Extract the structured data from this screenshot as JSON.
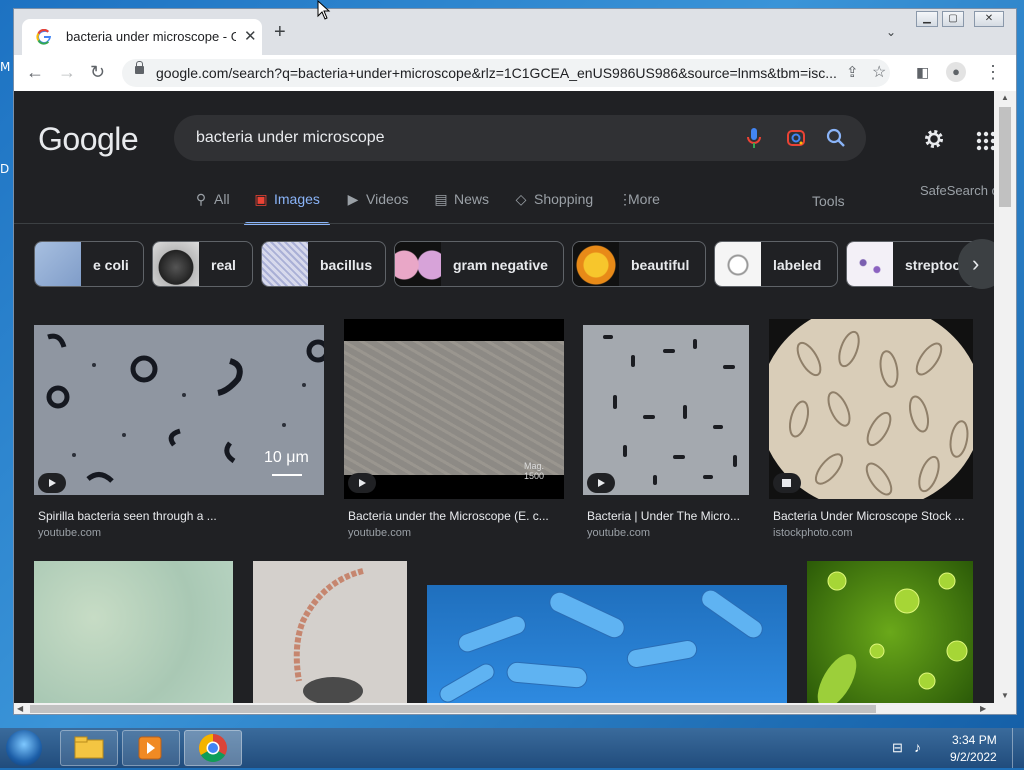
{
  "desktop": {
    "edge_texts": [
      "M",
      "D"
    ]
  },
  "browser": {
    "tab_title": "bacteria under microscope - Goo",
    "url": "google.com/search?q=bacteria+under+microscope&rlz=1C1GCEA_enUS986US986&source=lnms&tbm=isc..."
  },
  "google": {
    "logo": "Google",
    "query": "bacteria under microscope",
    "tabs": [
      {
        "label": "All",
        "icon": "search-icon"
      },
      {
        "label": "Images",
        "icon": "image-icon",
        "active": true
      },
      {
        "label": "Videos",
        "icon": "video-icon"
      },
      {
        "label": "News",
        "icon": "news-icon"
      },
      {
        "label": "Shopping",
        "icon": "tag-icon"
      },
      {
        "label": "More",
        "icon": "more-vert-icon"
      }
    ],
    "tools_label": "Tools",
    "safesearch_label": "SafeSearch o"
  },
  "chips": [
    "e coli",
    "real",
    "bacillus",
    "gram negative",
    "beautiful",
    "labeled",
    "streptoc"
  ],
  "results": [
    {
      "caption": "Spirilla bacteria seen through a ...",
      "source": "youtube.com",
      "badge": "play-icon",
      "scale_label": "10 μm"
    },
    {
      "caption": "Bacteria under the Microscope (E. c...",
      "source": "youtube.com",
      "badge": "play-icon",
      "overlay_text": "Mag. 1500"
    },
    {
      "caption": "Bacteria | Under The Micro...",
      "source": "youtube.com",
      "badge": "play-icon"
    },
    {
      "caption": "Bacteria Under Microscope Stock ...",
      "source": "istockphoto.com",
      "badge": "photo-icon"
    }
  ],
  "taskbar": {
    "time": "3:34 PM",
    "date": "9/2/2022"
  }
}
